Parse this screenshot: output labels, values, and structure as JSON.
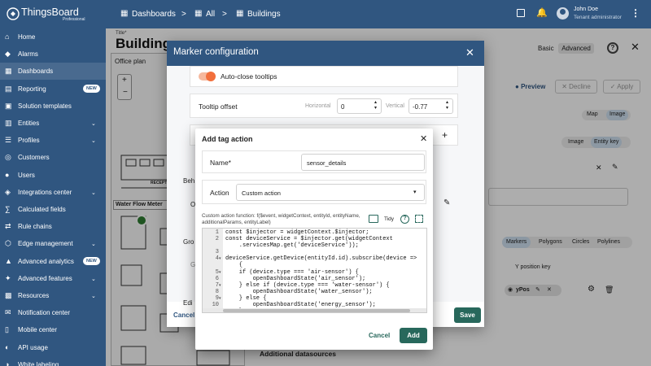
{
  "topbar": {
    "brand_name": "ThingsBoard",
    "brand_sub": "Professional",
    "breadcrumbs": [
      "Dashboards",
      "All",
      "Buildings"
    ],
    "user_name": "John Doe",
    "user_role": "Tenant administrator"
  },
  "sidebar": {
    "items": [
      {
        "label": "Home",
        "icon": "home-icon",
        "chevron": false,
        "badge": ""
      },
      {
        "label": "Alarms",
        "icon": "alarm-icon",
        "chevron": false,
        "badge": ""
      },
      {
        "label": "Dashboards",
        "icon": "dashboard-icon",
        "chevron": false,
        "badge": "",
        "active": true
      },
      {
        "label": "Reporting",
        "icon": "report-icon",
        "chevron": false,
        "badge": "NEW"
      },
      {
        "label": "Solution templates",
        "icon": "template-icon",
        "chevron": false,
        "badge": ""
      },
      {
        "label": "Entities",
        "icon": "entities-icon",
        "chevron": true,
        "badge": ""
      },
      {
        "label": "Profiles",
        "icon": "profiles-icon",
        "chevron": true,
        "badge": ""
      },
      {
        "label": "Customers",
        "icon": "customers-icon",
        "chevron": false,
        "badge": ""
      },
      {
        "label": "Users",
        "icon": "users-icon",
        "chevron": false,
        "badge": ""
      },
      {
        "label": "Integrations center",
        "icon": "integrations-icon",
        "chevron": true,
        "badge": ""
      },
      {
        "label": "Calculated fields",
        "icon": "calc-icon",
        "chevron": false,
        "badge": ""
      },
      {
        "label": "Rule chains",
        "icon": "rule-chain-icon",
        "chevron": false,
        "badge": ""
      },
      {
        "label": "Edge management",
        "icon": "edge-icon",
        "chevron": true,
        "badge": ""
      },
      {
        "label": "Advanced analytics",
        "icon": "analytics-icon",
        "chevron": false,
        "badge": "NEW"
      },
      {
        "label": "Advanced features",
        "icon": "features-icon",
        "chevron": true,
        "badge": ""
      },
      {
        "label": "Resources",
        "icon": "resources-icon",
        "chevron": true,
        "badge": ""
      },
      {
        "label": "Notification center",
        "icon": "notification-icon",
        "chevron": false,
        "badge": ""
      },
      {
        "label": "Mobile center",
        "icon": "mobile-icon",
        "chevron": false,
        "badge": ""
      },
      {
        "label": "API usage",
        "icon": "api-icon",
        "chevron": false,
        "badge": ""
      },
      {
        "label": "White labeling",
        "icon": "palette-icon",
        "chevron": false,
        "badge": ""
      }
    ]
  },
  "background": {
    "title_label": "Title*",
    "title_value": "Buildings",
    "office_plan_label": "Office plan",
    "water_flow_label": "Water Flow Meter",
    "reception_label": "RECEPT...",
    "basic_label": "Basic",
    "advanced_label": "Advanced",
    "preview_label": "Preview",
    "decline_label": "Decline",
    "apply_label": "Apply",
    "map_label": "Map",
    "image_label": "Image",
    "image_tab": "Image",
    "entity_key_tab": "Entity key",
    "markers_tab": "Markers",
    "polygons_tab": "Polygons",
    "circles_tab": "Circles",
    "polylines_tab": "Polylines",
    "y_position_key": "Y position key",
    "ypos_chip": "yPos",
    "additional_datasources": "Additional datasources"
  },
  "marker_dialog": {
    "title": "Marker configuration",
    "auto_close_label": "Auto-close tooltips",
    "auto_close_on": true,
    "tooltip_offset_label": "Tooltip offset",
    "horizontal_label": "Horizontal",
    "horizontal_value": "0",
    "vertical_label": "Vertical",
    "vertical_value": "-0.77",
    "beh_label": "Beh",
    "o_label": "O",
    "gro_label": "Gro",
    "g_label": "G",
    "edi_label": "Edi",
    "cancel_label": "Cancel",
    "save_label": "Save"
  },
  "tag_dialog": {
    "title": "Add tag action",
    "name_label": "Name*",
    "name_value": "sensor_details",
    "action_label": "Action",
    "action_value": "Custom action",
    "function_caption": "Custom action function: f($event, widgetContext, entityId, entityName, additionalParams, entityLabel)",
    "tidy_label": "Tidy",
    "code_lines": [
      {
        "n": "1",
        "fold": false,
        "text": "const $injector = widgetContext.$injector;"
      },
      {
        "n": "2",
        "fold": false,
        "text": "const deviceService = $injector.get(widgetContext"
      },
      {
        "n": "",
        "fold": false,
        "text": "    .servicesMap.get('deviceService'));"
      },
      {
        "n": "3",
        "fold": false,
        "text": ""
      },
      {
        "n": "4",
        "fold": true,
        "text": "deviceService.getDevice(entityId.id).subscribe(device =>"
      },
      {
        "n": "",
        "fold": false,
        "text": "    {"
      },
      {
        "n": "5",
        "fold": true,
        "text": "    if (device.type === 'air-sensor') {"
      },
      {
        "n": "6",
        "fold": false,
        "text": "        openDashboardState('air_sensor');"
      },
      {
        "n": "7",
        "fold": true,
        "text": "    } else if (device.type === 'water-sensor') {"
      },
      {
        "n": "8",
        "fold": false,
        "text": "        openDashboardState('water_sensor');"
      },
      {
        "n": "9",
        "fold": true,
        "text": "    } else {"
      },
      {
        "n": "10",
        "fold": false,
        "text": "        openDashboardState('energy_sensor');"
      },
      {
        "n": "11",
        "fold": false,
        "text": "    }"
      }
    ],
    "cancel_label": "Cancel",
    "add_label": "Add"
  },
  "colors": {
    "primary": "#305680",
    "accent": "#28685c",
    "toggle": "#f26f3c"
  }
}
